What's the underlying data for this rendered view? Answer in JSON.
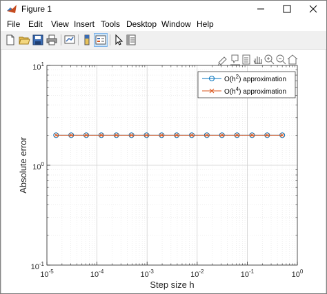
{
  "window": {
    "title": "Figure 1",
    "colors": {
      "titlebar": "#ffffff",
      "frame": "#f0f0f0",
      "axes_bg": "#ffffff"
    }
  },
  "menubar": {
    "items": [
      "File",
      "Edit",
      "View",
      "Insert",
      "Tools",
      "Desktop",
      "Window",
      "Help"
    ]
  },
  "toolbar": {
    "icons": [
      "new-figure-icon",
      "open-file-icon",
      "save-icon",
      "print-icon",
      "link-plot-icon",
      "colorbar-icon",
      "legend-icon",
      "edit-plot-icon",
      "property-inspector-icon"
    ]
  },
  "axes_toolbar": {
    "icons": [
      "brush-icon",
      "data-tips-icon",
      "rotate-icon",
      "pan-icon",
      "zoom-in-icon",
      "zoom-out-icon",
      "home-icon"
    ]
  },
  "chart_data": {
    "type": "line",
    "xlabel": "Step size h",
    "ylabel": "Absolute error",
    "xscale": "log",
    "yscale": "log",
    "xlim": [
      1e-05,
      1
    ],
    "ylim": [
      0.1,
      10
    ],
    "x_ticks": [
      "10-5",
      "10-4",
      "10-3",
      "10-2",
      "10-1",
      "100"
    ],
    "y_ticks": [
      "10-1",
      "100",
      "101"
    ],
    "grid": true,
    "minor_grid": true,
    "legend": "top-right",
    "x": [
      1.52587890625e-05,
      3.0517578125e-05,
      6.103515625e-05,
      0.0001220703125,
      0.000244140625,
      0.00048828125,
      0.0009765625,
      0.001953125,
      0.00390625,
      0.0078125,
      0.015625,
      0.03125,
      0.0625,
      0.125,
      0.25,
      0.5
    ],
    "series": [
      {
        "name": "O(h2) approximation",
        "label_base": "O(h",
        "label_sup": "2",
        "label_rest": ") approximation",
        "color": "#0072bd",
        "marker": "circle",
        "values": [
          2,
          2,
          2,
          2,
          2,
          2,
          2,
          2,
          2,
          2,
          2,
          2,
          2,
          2,
          2,
          2
        ]
      },
      {
        "name": "O(h4) approximation",
        "label_base": "O(h",
        "label_sup": "4",
        "label_rest": ") approximation",
        "color": "#d95319",
        "marker": "x",
        "values": [
          2,
          2,
          2,
          2,
          2,
          2,
          2,
          2,
          2,
          2,
          2,
          2,
          2,
          2,
          2,
          2
        ]
      }
    ]
  }
}
